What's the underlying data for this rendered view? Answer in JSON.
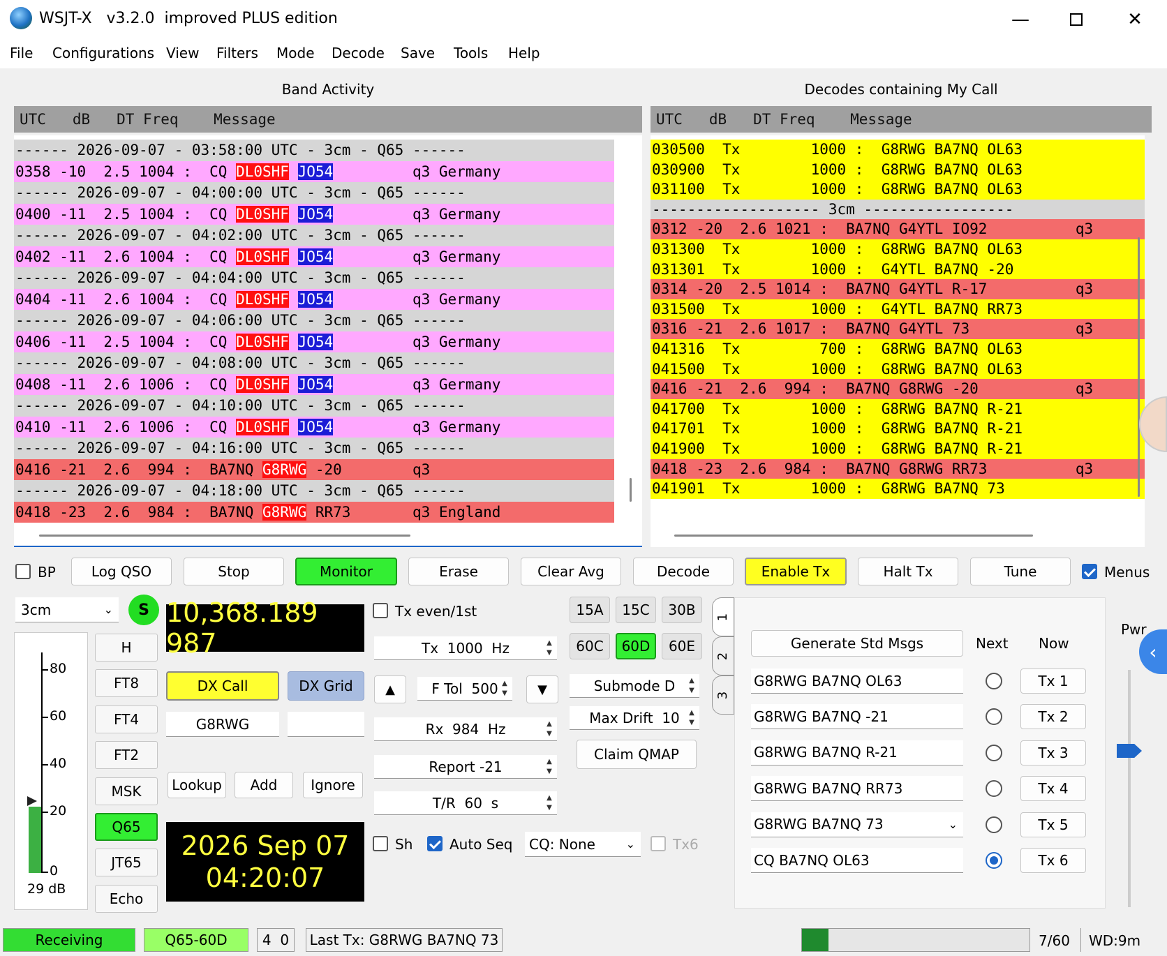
{
  "window": {
    "title": "WSJT-X   v3.2.0  improved PLUS edition"
  },
  "menu": [
    "File",
    "Configurations",
    "View",
    "Filters",
    "Mode",
    "Decode",
    "Save",
    "Tools",
    "Help"
  ],
  "band_activity": {
    "title": "Band Activity",
    "header": "UTC   dB   DT Freq    Message",
    "rows": [
      {
        "type": "sep",
        "text": "------ 2026-09-07 - 03:58:00 UTC - 3cm - Q65 ------"
      },
      {
        "type": "msg",
        "color": "pink",
        "pre": "0358 -10  2.5 1004 :  CQ ",
        "call": "DL0SHF",
        "grid": "JO54",
        "post": "         q3 Germany",
        "call_color": "red"
      },
      {
        "type": "sep",
        "text": "------ 2026-09-07 - 04:00:00 UTC - 3cm - Q65 ------"
      },
      {
        "type": "msg",
        "color": "pink",
        "pre": "0400 -11  2.5 1004 :  CQ ",
        "call": "DL0SHF",
        "grid": "JO54",
        "post": "         q3 Germany",
        "call_color": "red"
      },
      {
        "type": "sep",
        "text": "------ 2026-09-07 - 04:02:00 UTC - 3cm - Q65 ------"
      },
      {
        "type": "msg",
        "color": "pink",
        "pre": "0402 -11  2.6 1004 :  CQ ",
        "call": "DL0SHF",
        "grid": "JO54",
        "post": "         q3 Germany",
        "call_color": "red"
      },
      {
        "type": "sep",
        "text": "------ 2026-09-07 - 04:04:00 UTC - 3cm - Q65 ------"
      },
      {
        "type": "msg",
        "color": "pink",
        "pre": "0404 -11  2.6 1004 :  CQ ",
        "call": "DL0SHF",
        "grid": "JO54",
        "post": "         q3 Germany",
        "call_color": "red"
      },
      {
        "type": "sep",
        "text": "------ 2026-09-07 - 04:06:00 UTC - 3cm - Q65 ------"
      },
      {
        "type": "msg",
        "color": "pink",
        "pre": "0406 -11  2.5 1004 :  CQ ",
        "call": "DL0SHF",
        "grid": "JO54",
        "post": "         q3 Germany",
        "call_color": "red"
      },
      {
        "type": "sep",
        "text": "------ 2026-09-07 - 04:08:00 UTC - 3cm - Q65 ------"
      },
      {
        "type": "msg",
        "color": "pink",
        "pre": "0408 -11  2.6 1006 :  CQ ",
        "call": "DL0SHF",
        "grid": "JO54",
        "post": "         q3 Germany",
        "call_color": "red"
      },
      {
        "type": "sep",
        "text": "------ 2026-09-07 - 04:10:00 UTC - 3cm - Q65 ------"
      },
      {
        "type": "msg",
        "color": "pink",
        "pre": "0410 -11  2.6 1006 :  CQ ",
        "call": "DL0SHF",
        "grid": "JO54",
        "post": "         q3 Germany",
        "call_color": "red"
      },
      {
        "type": "sep",
        "text": "------ 2026-09-07 - 04:16:00 UTC - 3cm - Q65 ------"
      },
      {
        "type": "msg",
        "color": "red",
        "pre": "0416 -21  2.6  994 :  BA7NQ ",
        "call": "G8RWG",
        "grid": "",
        "post": " -20        q3",
        "call_color": "red"
      },
      {
        "type": "sep",
        "text": "------ 2026-09-07 - 04:18:00 UTC - 3cm - Q65 ------"
      },
      {
        "type": "msg",
        "color": "red",
        "pre": "0418 -23  2.6  984 :  BA7NQ ",
        "call": "G8RWG",
        "grid": "",
        "post": " RR73       q3 England",
        "call_color": "red"
      }
    ]
  },
  "my_call": {
    "title": "Decodes containing My Call",
    "header": "UTC   dB   DT Freq    Message",
    "rows": [
      {
        "color": "yellow",
        "text": "030500  Tx        1000 :  G8RWG BA7NQ OL63"
      },
      {
        "color": "yellow",
        "text": "030900  Tx        1000 :  G8RWG BA7NQ OL63"
      },
      {
        "color": "yellow",
        "text": "031100  Tx        1000 :  G8RWG BA7NQ OL63"
      },
      {
        "color": "grey",
        "text": "------------------- 3cm -----------------"
      },
      {
        "color": "red",
        "text": "0312 -20  2.6 1021 :  BA7NQ G4YTL IO92          q3"
      },
      {
        "color": "yellow",
        "text": "031300  Tx        1000 :  G8RWG BA7NQ OL63"
      },
      {
        "color": "yellow",
        "text": "031301  Tx        1000 :  G4YTL BA7NQ -20"
      },
      {
        "color": "red",
        "text": "0314 -20  2.5 1014 :  BA7NQ G4YTL R-17          q3"
      },
      {
        "color": "yellow",
        "text": "031500  Tx        1000 :  G4YTL BA7NQ RR73"
      },
      {
        "color": "red",
        "text": "0316 -21  2.6 1017 :  BA7NQ G4YTL 73            q3"
      },
      {
        "color": "yellow",
        "text": "041316  Tx         700 :  G8RWG BA7NQ OL63"
      },
      {
        "color": "yellow",
        "text": "041500  Tx        1000 :  G8RWG BA7NQ OL63"
      },
      {
        "color": "red",
        "text": "0416 -21  2.6  994 :  BA7NQ G8RWG -20           q3"
      },
      {
        "color": "yellow",
        "text": "041700  Tx        1000 :  G8RWG BA7NQ R-21"
      },
      {
        "color": "yellow",
        "text": "041701  Tx        1000 :  G8RWG BA7NQ R-21"
      },
      {
        "color": "yellow",
        "text": "041900  Tx        1000 :  G8RWG BA7NQ R-21"
      },
      {
        "color": "red",
        "text": "0418 -23  2.6  984 :  BA7NQ G8RWG RR73          q3"
      },
      {
        "color": "yellow",
        "text": "041901  Tx        1000 :  G8RWG BA7NQ 73"
      }
    ]
  },
  "controls": {
    "bp_label": "BP",
    "buttons": {
      "log_qso": "Log QSO",
      "stop": "Stop",
      "monitor": "Monitor",
      "erase": "Erase",
      "clear_avg": "Clear Avg",
      "decode": "Decode",
      "enable_tx": "Enable Tx",
      "halt_tx": "Halt Tx",
      "tune": "Tune"
    },
    "menus_label": "Menus",
    "band": "3cm",
    "s_label": "S",
    "frequency": "10,368.189 987",
    "meter_ticks": [
      "80",
      "60",
      "40",
      "20",
      "0"
    ],
    "meter_level_fraction": 0.3,
    "meter_db": "29 dB",
    "modes": [
      "H",
      "FT8",
      "FT4",
      "FT2",
      "MSK",
      "Q65",
      "JT65",
      "Echo"
    ],
    "active_mode": "Q65",
    "dx_call_label": "DX Call",
    "dx_grid_label": "DX Grid",
    "dx_call_value": "G8RWG",
    "dx_grid_value": "",
    "lookup": "Lookup",
    "add": "Add",
    "ignore": "Ignore",
    "date": "2026 Sep 07",
    "time": "04:20:07",
    "tx_even_label": "Tx even/1st",
    "tx_freq": "Tx  1000  Hz",
    "ftol": "F Tol  500",
    "rx_freq": "Rx  984  Hz",
    "report": "Report -21",
    "tr": "T/R  60  s",
    "sh_label": "Sh",
    "auto_seq_label": "Auto Seq",
    "cq_select": "CQ: None",
    "tx6_label": "Tx6",
    "submodes": [
      "15A",
      "15C",
      "30B",
      "60C",
      "60D",
      "60E"
    ],
    "active_submode": "60D",
    "submode_spin": "Submode D",
    "max_drift": "Max Drift  10",
    "claim_qmap": "Claim QMAP",
    "tabs": [
      "1",
      "2",
      "3"
    ],
    "generate": "Generate Std Msgs",
    "next_label": "Next",
    "now_label": "Now",
    "tx_msgs": [
      "G8RWG BA7NQ OL63",
      "G8RWG BA7NQ -21",
      "G8RWG BA7NQ R-21",
      "G8RWG BA7NQ RR73",
      "G8RWG BA7NQ 73",
      "CQ BA7NQ OL63"
    ],
    "tx_buttons": [
      "Tx 1",
      "Tx 2",
      "Tx 3",
      "Tx 4",
      "Tx 5",
      "Tx 6"
    ],
    "selected_next": 6,
    "pwr_label": "Pwr"
  },
  "status": {
    "receiving": "Receiving",
    "mode": "Q65-60D",
    "counts": "4  0",
    "last_tx": "Last Tx: G8RWG BA7NQ 73",
    "progress_fraction": 0.117,
    "progress_text": "7/60",
    "wd": "WD:9m"
  },
  "colors": {
    "pink": "#ffa8ff",
    "grey": "#d6d6d6",
    "red": "#f36b6b",
    "yellow": "#ffff00",
    "green": "#33dd33",
    "accent": "#1e66c8"
  }
}
